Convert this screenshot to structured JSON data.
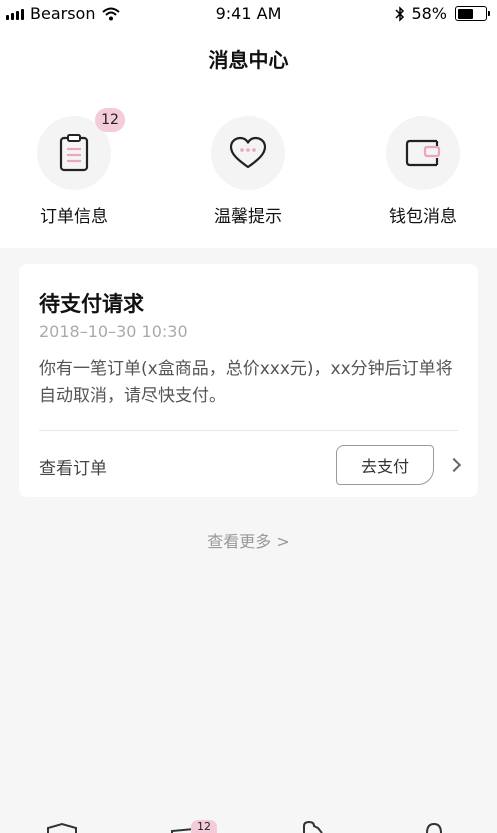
{
  "status_bar": {
    "carrier": "Bearson",
    "time": "9:41 AM",
    "battery": "58%",
    "battery_level": 0.58
  },
  "header": {
    "title": "消息中心"
  },
  "categories": [
    {
      "label": "订单信息",
      "badge": "12",
      "icon": "clipboard-icon"
    },
    {
      "label": "温馨提示",
      "icon": "heart-chat-icon"
    },
    {
      "label": "钱包消息",
      "icon": "wallet-icon"
    }
  ],
  "card": {
    "title": "待支付请求",
    "time": "2018–10–30 10:30",
    "body": "你有一笔订单(x盒商品，总价xxx元)，xx分钟后订单将自动取消，请尽快支付。",
    "link_label": "查看订单",
    "pay_label": "去支付"
  },
  "more_label": "查看更多 >",
  "tab_bar": {
    "badge": "12"
  },
  "colors": {
    "accent_pink": "#f4cbd9",
    "icon_pink": "#e8a6bf",
    "background": "#f6f6f6"
  }
}
